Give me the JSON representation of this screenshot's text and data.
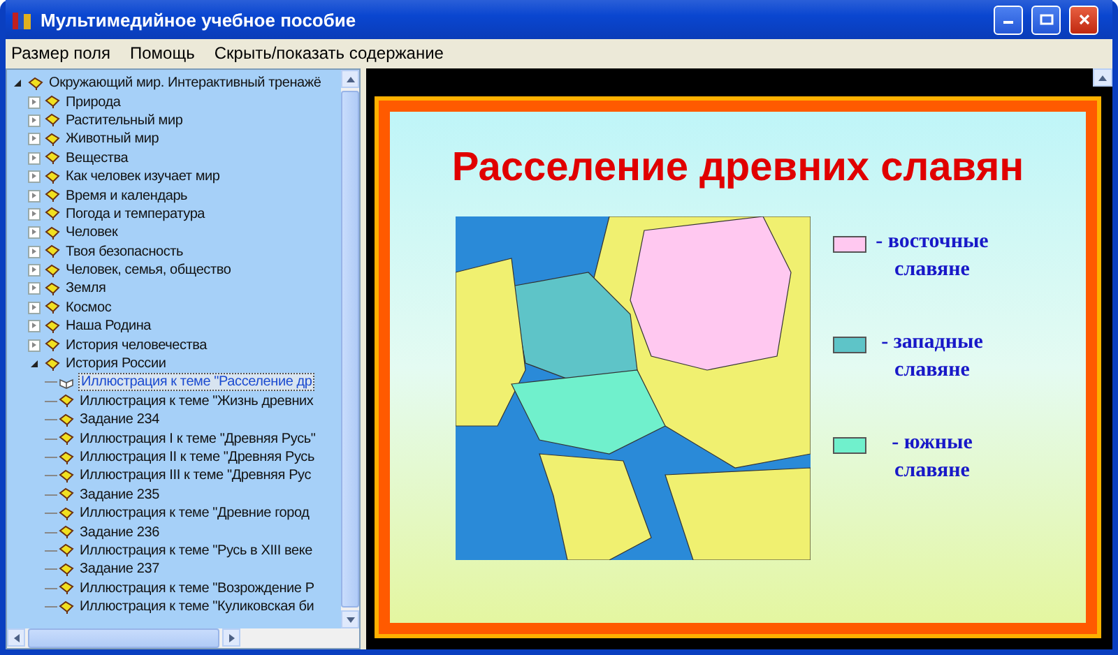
{
  "window": {
    "title": "Мультимедийное учебное пособие"
  },
  "menu": [
    {
      "label": "Размер поля"
    },
    {
      "label": "Помощь"
    },
    {
      "label": "Скрыть/показать содержание"
    }
  ],
  "tree": [
    {
      "label": "Окружающий мир. Интерактивный тренажё",
      "expanded": true,
      "selected": false,
      "children": [
        {
          "label": "Природа",
          "expanded": false,
          "selected": false
        },
        {
          "label": "Растительный мир",
          "expanded": false,
          "selected": false
        },
        {
          "label": "Животный мир",
          "expanded": false,
          "selected": false
        },
        {
          "label": "Вещества",
          "expanded": false,
          "selected": false
        },
        {
          "label": "Как человек изучает мир",
          "expanded": false,
          "selected": false
        },
        {
          "label": "Время и календарь",
          "expanded": false,
          "selected": false
        },
        {
          "label": "Погода и температура",
          "expanded": false,
          "selected": false
        },
        {
          "label": "Человек",
          "expanded": false,
          "selected": false
        },
        {
          "label": "Твоя безопасность",
          "expanded": false,
          "selected": false
        },
        {
          "label": "Человек, семья, общество",
          "expanded": false,
          "selected": false
        },
        {
          "label": "Земля",
          "expanded": false,
          "selected": false
        },
        {
          "label": "Космос",
          "expanded": false,
          "selected": false
        },
        {
          "label": "Наша Родина",
          "expanded": false,
          "selected": false
        },
        {
          "label": "История человечества",
          "expanded": false,
          "selected": false
        },
        {
          "label": "История России",
          "expanded": true,
          "selected": false,
          "children": [
            {
              "label": "Иллюстрация к теме \"Расселение др",
              "selected": true
            },
            {
              "label": "Иллюстрация к теме \"Жизнь древних",
              "selected": false
            },
            {
              "label": "Задание 234",
              "selected": false
            },
            {
              "label": "Иллюстрация I к теме \"Древняя Русь\"",
              "selected": false
            },
            {
              "label": "Иллюстрация II к теме \"Древняя Русь",
              "selected": false
            },
            {
              "label": "Иллюстрация III к теме \"Древняя Рус",
              "selected": false
            },
            {
              "label": "Задание 235",
              "selected": false
            },
            {
              "label": "Иллюстрация к теме \"Древние город",
              "selected": false
            },
            {
              "label": "Задание 236",
              "selected": false
            },
            {
              "label": "Иллюстрация к теме \"Русь в XIII веке",
              "selected": false
            },
            {
              "label": "Задание 237",
              "selected": false
            },
            {
              "label": "Иллюстрация к теме \"Возрождение Р",
              "selected": false
            },
            {
              "label": "Иллюстрация к теме \"Куликовская би",
              "selected": false
            }
          ]
        }
      ]
    }
  ],
  "slide": {
    "title": "Расселение древних славян",
    "legend": [
      {
        "text": "- восточные славяне",
        "color": "#ffc8f0"
      },
      {
        "text": "- западные славяне",
        "color": "#5ec4c8"
      },
      {
        "text": "- южные славяне",
        "color": "#70f0cc"
      }
    ]
  }
}
